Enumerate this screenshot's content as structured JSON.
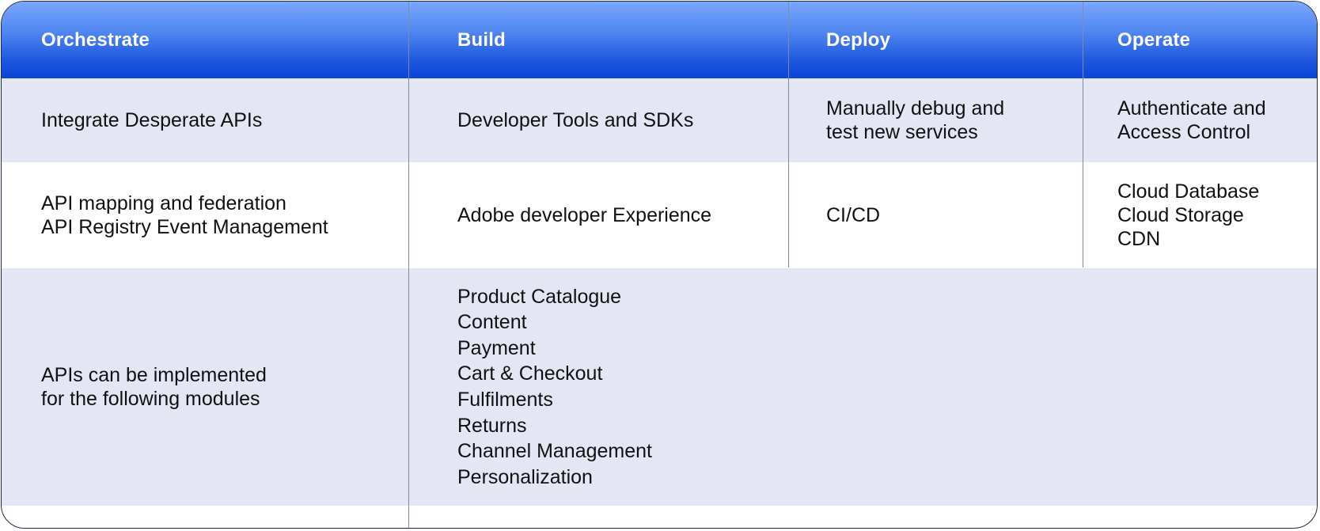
{
  "table": {
    "headers": [
      "Orchestrate",
      "Build",
      "Deploy",
      "Operate"
    ],
    "rows": [
      {
        "orchestrate": [
          "Integrate Desperate APIs"
        ],
        "build": [
          "Developer Tools and SDKs"
        ],
        "deploy": [
          "Manually debug and",
          "test new services"
        ],
        "operate": [
          "Authenticate and",
          "Access Control"
        ]
      },
      {
        "orchestrate": [
          "API mapping and federation",
          "API Registry Event Management"
        ],
        "build": [
          "Adobe developer Experience"
        ],
        "deploy": [
          "CI/CD"
        ],
        "operate": [
          "Cloud Database",
          "Cloud Storage",
          "CDN"
        ]
      },
      {
        "orchestrate": [
          "APIs can be implemented",
          "for the following modules"
        ],
        "modules": [
          "Product Catalogue",
          "Content",
          "Payment",
          "Cart & Checkout",
          "Fulfilments",
          "Returns",
          "Channel Management",
          "Personalization"
        ]
      }
    ]
  },
  "colors": {
    "header_gradient_top": "#7ba7ff",
    "header_gradient_bottom": "#0a43d6",
    "row_shaded": "#e4e7f3",
    "row_plain": "#ffffff",
    "divider": "#7f8aa8"
  }
}
